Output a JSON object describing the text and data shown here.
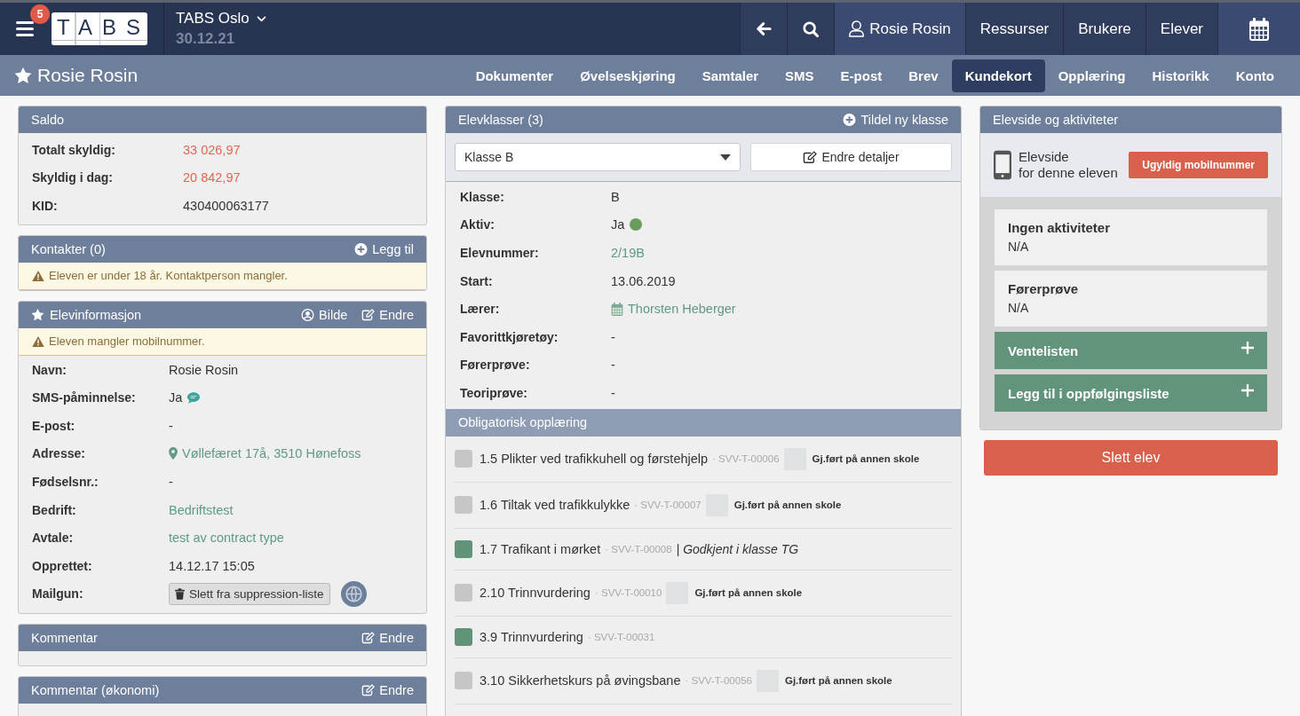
{
  "top_bar": {
    "notifications": "5",
    "logo": "TABS",
    "school": "TABS Oslo",
    "date": "30.12.21",
    "nav": [
      {
        "kind": "back",
        "highlighted": false
      },
      {
        "kind": "search",
        "highlighted": false
      },
      {
        "kind": "user",
        "label": "Rosie Rosin",
        "highlighted": true
      },
      {
        "kind": "link",
        "label": "Ressurser",
        "highlighted": false
      },
      {
        "kind": "link",
        "label": "Brukere",
        "highlighted": false
      },
      {
        "kind": "link",
        "label": "Elever",
        "highlighted": false
      },
      {
        "kind": "calendar",
        "highlighted": true
      }
    ]
  },
  "student_bar": {
    "name": "Rosie Rosin",
    "tabs": [
      {
        "label": "Dokumenter",
        "selected": false
      },
      {
        "label": "Øvelseskjøring",
        "selected": false
      },
      {
        "label": "Samtaler",
        "selected": false
      },
      {
        "label": "SMS",
        "selected": false
      },
      {
        "label": "E-post",
        "selected": false
      },
      {
        "label": "Brev",
        "selected": false
      },
      {
        "label": "Kundekort",
        "selected": true
      },
      {
        "label": "Opplæring",
        "selected": false
      },
      {
        "label": "Historikk",
        "selected": false
      },
      {
        "label": "Konto",
        "selected": false
      }
    ]
  },
  "saldo": {
    "title": "Saldo",
    "rows": [
      {
        "label": "Totalt skyldig:",
        "value": "33 026,97",
        "kind": "debt"
      },
      {
        "label": "Skyldig i dag:",
        "value": "20 842,97",
        "kind": "debt"
      },
      {
        "label": "KID:",
        "value": "430400063177",
        "kind": "text"
      }
    ]
  },
  "contacts": {
    "title": "Kontakter (0)",
    "actions": [
      {
        "kind": "add",
        "label": "Legg til"
      }
    ],
    "warning": "Eleven er under 18 år. Kontaktperson mangler."
  },
  "student_info": {
    "title": "Elevinformasjon",
    "actions": [
      {
        "kind": "photo",
        "label": "Bilde"
      },
      {
        "kind": "edit",
        "label": "Endre"
      }
    ],
    "warning": "Eleven mangler mobilnummer.",
    "rows": [
      {
        "label": "Navn:",
        "value": "Rosie Rosin",
        "kind": "text"
      },
      {
        "label": "SMS-påminnelse:",
        "value": "Ja",
        "kind": "sms"
      },
      {
        "label": "E-post:",
        "value": "-",
        "kind": "text"
      },
      {
        "label": "Adresse:",
        "value": "Vøllefæret 17å, 3510 Hønefoss",
        "kind": "address"
      },
      {
        "label": "Fødselsnr.:",
        "value": "-",
        "kind": "text"
      },
      {
        "label": "Bedrift:",
        "value": "Bedriftstest",
        "kind": "link"
      },
      {
        "label": "Avtale:",
        "value": "test av contract type",
        "kind": "link"
      },
      {
        "label": "Opprettet:",
        "value": "14.12.17 15:05",
        "kind": "text"
      },
      {
        "label": "Mailgun:",
        "value": "Slett fra suppression-liste",
        "kind": "mailgun"
      }
    ]
  },
  "comments": [
    {
      "title": "Kommentar",
      "actions": [
        {
          "kind": "edit",
          "label": "Endre"
        }
      ]
    },
    {
      "title": "Kommentar (økonomi)",
      "actions": [
        {
          "kind": "edit",
          "label": "Endre"
        }
      ]
    }
  ],
  "classes": {
    "title": "Elevklasser (3)",
    "actions": [
      {
        "kind": "add",
        "label": "Tildel ny klasse"
      }
    ],
    "select": {
      "value": "Klasse B"
    },
    "edit_button": "Endre detaljer",
    "rows": [
      {
        "label": "Klasse:",
        "value": "B",
        "kind": "text"
      },
      {
        "label": "Aktiv:",
        "value": "Ja",
        "kind": "status",
        "color": "#6a9c5c"
      },
      {
        "label": "Elevnummer:",
        "value": "2/19B",
        "kind": "link"
      },
      {
        "label": "Start:",
        "value": "13.06.2019",
        "kind": "text"
      },
      {
        "label": "Lærer:",
        "value": "Thorsten Heberger",
        "kind": "teacher"
      },
      {
        "label": "Favorittkjøretøy:",
        "value": "-",
        "kind": "text"
      },
      {
        "label": "Førerprøve:",
        "value": "-",
        "kind": "text"
      },
      {
        "label": "Teoriprøve:",
        "value": "-",
        "kind": "text"
      }
    ]
  },
  "training": {
    "title": "Obligatorisk opplæring",
    "items": [
      {
        "title": "1.5 Plikter ved trafikkuhell og førstehjelp",
        "ref": "· SVV-T-00006",
        "checked": false,
        "kind": "external",
        "done_elsewhere": false,
        "note": "Gj.ført på annen skole"
      },
      {
        "title": "1.6 Tiltak ved trafikkulykke",
        "ref": "· SVV-T-00007",
        "checked": false,
        "kind": "external",
        "done_elsewhere": false,
        "note": "Gj.ført på annen skole"
      },
      {
        "title": "1.7 Trafikant i mørket",
        "ref": "· SVV-T-00008",
        "checked": true,
        "kind": "approved",
        "note": "| *Godkjent i klasse TG*"
      },
      {
        "title": "2.10 Trinnvurdering",
        "ref": "· SVV-T-00010",
        "checked": false,
        "kind": "external",
        "done_elsewhere": false,
        "note": "Gj.ført på annen skole"
      },
      {
        "title": "3.9 Trinnvurdering",
        "ref": "· SVV-T-00031",
        "checked": true,
        "kind": "plain"
      },
      {
        "title": "3.10 Sikkerhetskurs på øvingsbane",
        "ref": "· SVV-T-00056",
        "checked": false,
        "kind": "external",
        "done_elsewhere": false,
        "note": "Gj.ført på annen skole"
      }
    ]
  },
  "student_page": {
    "title": "Elevside og aktiviteter",
    "label_lines": [
      "Elevside",
      "for denne eleven"
    ],
    "status_button": "Ugyldig mobilnummer",
    "cards": [
      {
        "title": "Ingen aktiviteter",
        "value": "N/A"
      },
      {
        "title": "Førerprøve",
        "value": "N/A"
      }
    ],
    "actions": [
      "Ventelisten",
      "Legg til i oppfølgingsliste"
    ]
  },
  "delete_button": "Slett elev"
}
